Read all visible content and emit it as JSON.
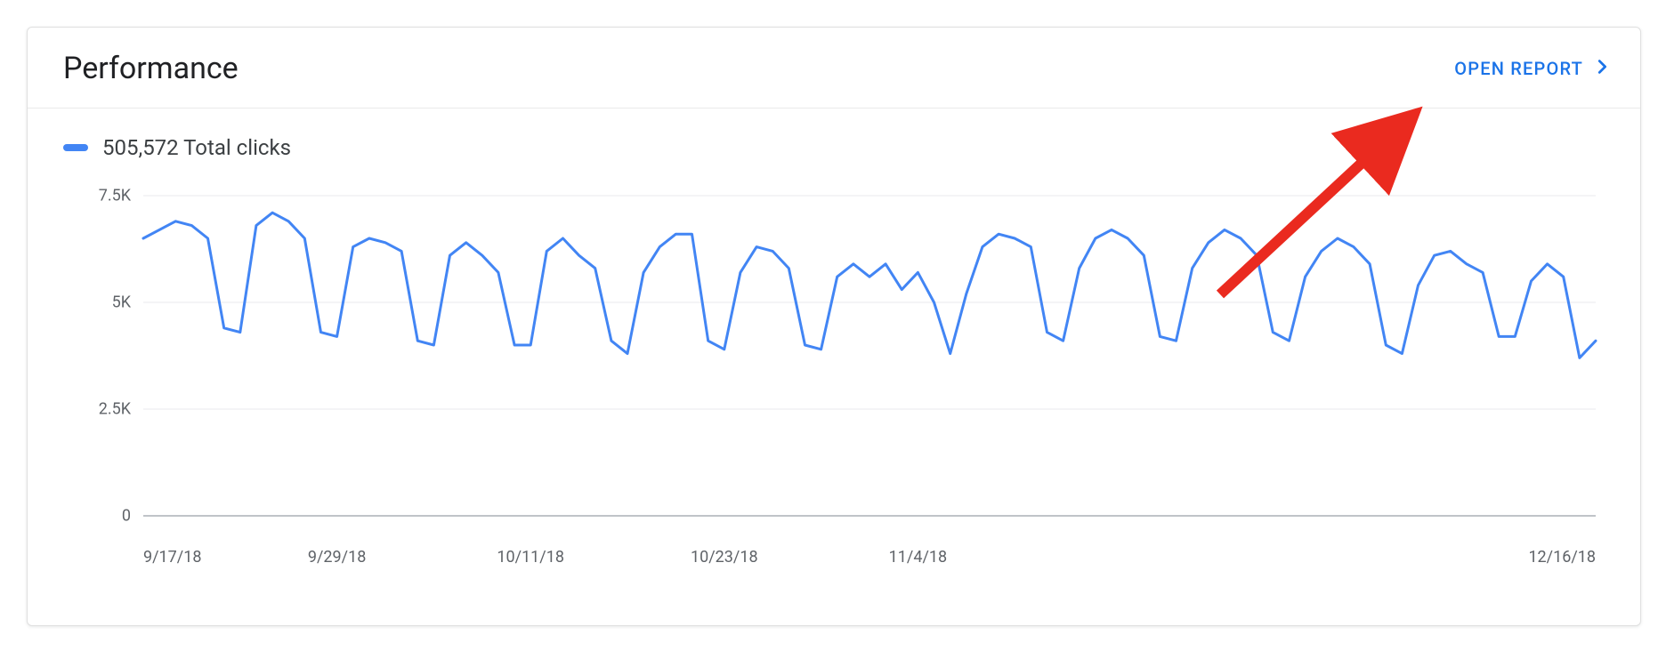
{
  "card": {
    "title": "Performance",
    "open_report_label": "OPEN REPORT"
  },
  "legend": {
    "color": "#4285f4",
    "label": "505,572 Total clicks"
  },
  "chart_data": {
    "type": "line",
    "title": "Performance",
    "ylabel": "",
    "xlabel": "",
    "ylim": [
      0,
      7500
    ],
    "y_ticks": [
      0,
      2500,
      5000,
      7500
    ],
    "y_tick_labels": [
      "0",
      "2.5K",
      "5K",
      "7.5K"
    ],
    "x_tick_labels": [
      "9/17/18",
      "9/29/18",
      "10/11/18",
      "10/23/18",
      "11/4/18",
      "12/16/18"
    ],
    "x_tick_indices": [
      0,
      12,
      24,
      36,
      48,
      90
    ],
    "x": [
      0,
      1,
      2,
      3,
      4,
      5,
      6,
      7,
      8,
      9,
      10,
      11,
      12,
      13,
      14,
      15,
      16,
      17,
      18,
      19,
      20,
      21,
      22,
      23,
      24,
      25,
      26,
      27,
      28,
      29,
      30,
      31,
      32,
      33,
      34,
      35,
      36,
      37,
      38,
      39,
      40,
      41,
      42,
      43,
      44,
      45,
      46,
      47,
      48,
      49,
      50,
      51,
      52,
      53,
      54,
      55,
      56,
      57,
      58,
      59,
      60,
      61,
      62,
      63,
      64,
      65,
      66,
      67,
      68,
      69,
      70,
      71,
      72,
      73,
      74,
      75,
      76,
      77,
      78,
      79,
      80,
      81,
      82,
      83,
      84,
      85,
      86,
      87,
      88,
      89,
      90
    ],
    "series": [
      {
        "name": "Total clicks",
        "color": "#4285f4",
        "values": [
          6500,
          6700,
          6900,
          6800,
          6500,
          4400,
          4300,
          6800,
          7100,
          6900,
          6500,
          4300,
          4200,
          6300,
          6500,
          6400,
          6200,
          4100,
          4000,
          6100,
          6400,
          6100,
          5700,
          4000,
          4000,
          6200,
          6500,
          6100,
          5800,
          4100,
          3800,
          5700,
          6300,
          6600,
          6600,
          4100,
          3900,
          5700,
          6300,
          6200,
          5800,
          4000,
          3900,
          5600,
          5900,
          5600,
          5900,
          5300,
          5700,
          5000,
          3800,
          5200,
          6300,
          6600,
          6500,
          6300,
          4300,
          4100,
          5800,
          6500,
          6700,
          6500,
          6100,
          4200,
          4100,
          5800,
          6400,
          6700,
          6500,
          6100,
          4300,
          4100,
          5600,
          6200,
          6500,
          6300,
          5900,
          4000,
          3800,
          5400,
          6100,
          6200,
          5900,
          5700,
          4200,
          4200,
          5500,
          5900,
          5600,
          3700,
          4100
        ]
      }
    ],
    "legend_position": "top-left",
    "grid": true
  },
  "annotation": {
    "arrow_color": "#ea2a1f"
  }
}
